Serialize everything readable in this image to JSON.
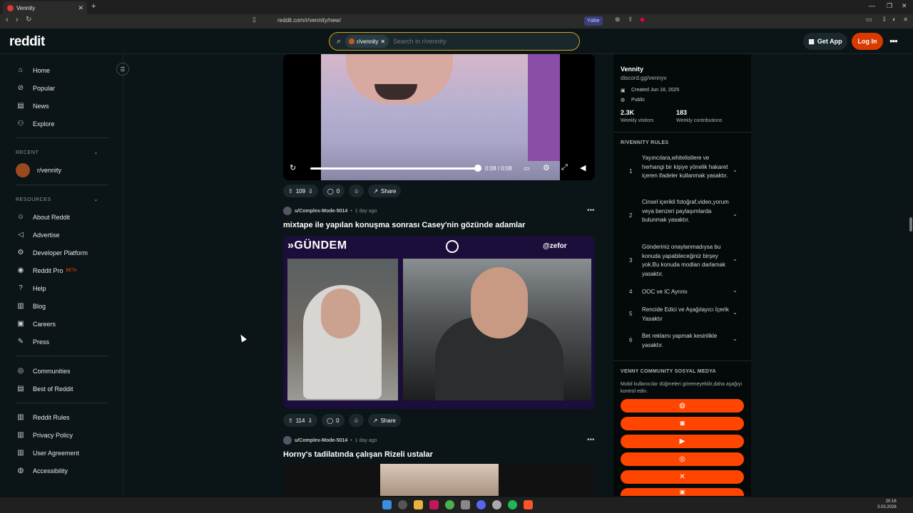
{
  "browser": {
    "tab_title": "Vennity",
    "url": "reddit.com/r/vennity/new/",
    "translate_label": "Yükle",
    "new_tab": "+",
    "close_tab": "✕"
  },
  "header": {
    "logo": "reddit",
    "search_chip": "r/vennity",
    "search_placeholder": "Search in r/vennity",
    "get_app": "Get App",
    "login": "Log In"
  },
  "sidebar": {
    "primary": [
      {
        "label": "Home",
        "icon": "home-icon",
        "glyph": "⌂"
      },
      {
        "label": "Popular",
        "icon": "popular-icon",
        "glyph": "⊘"
      },
      {
        "label": "News",
        "icon": "news-icon",
        "glyph": "▤"
      },
      {
        "label": "Explore",
        "icon": "explore-icon",
        "glyph": "⚇"
      }
    ],
    "recent_header": "RECENT",
    "recent": [
      {
        "label": "r/vennity"
      }
    ],
    "resources_header": "RESOURCES",
    "resources": [
      {
        "label": "About Reddit",
        "icon": "about-icon",
        "glyph": "☺"
      },
      {
        "label": "Advertise",
        "icon": "advertise-icon",
        "glyph": "📢"
      },
      {
        "label": "Developer Platform",
        "icon": "developer-icon",
        "glyph": "⚙"
      },
      {
        "label": "Reddit Pro",
        "icon": "pro-icon",
        "glyph": "◉",
        "badge": "BETA"
      },
      {
        "label": "Help",
        "icon": "help-icon",
        "glyph": "?"
      },
      {
        "label": "Blog",
        "icon": "blog-icon",
        "glyph": "▥"
      },
      {
        "label": "Careers",
        "icon": "careers-icon",
        "glyph": "▣"
      },
      {
        "label": "Press",
        "icon": "press-icon",
        "glyph": "✎"
      }
    ],
    "group3": [
      {
        "label": "Communities",
        "icon": "communities-icon",
        "glyph": "◎"
      },
      {
        "label": "Best of Reddit",
        "icon": "best-icon",
        "glyph": "▤"
      }
    ],
    "group4": [
      {
        "label": "Reddit Rules",
        "icon": "rules-icon",
        "glyph": "▥"
      },
      {
        "label": "Privacy Policy",
        "icon": "privacy-icon",
        "glyph": "▥"
      },
      {
        "label": "User Agreement",
        "icon": "agreement-icon",
        "glyph": "▥"
      },
      {
        "label": "Accessibility",
        "icon": "accessibility-icon",
        "glyph": "◍"
      }
    ]
  },
  "feed": {
    "video": {
      "time": "0:08 / 0:08",
      "progress": 1.0
    },
    "post1": {
      "votes": "109",
      "comments": "0",
      "share": "Share"
    },
    "post2": {
      "author": "u/Complex-Mode-5014",
      "age": "1 day ago",
      "title": "mixtape ile yapılan konuşma sonrası Casey'nin gözünde adamlar",
      "overlay_left": "GÜNDEM",
      "overlay_right": "@zefor",
      "votes": "114",
      "comments": "0",
      "share": "Share"
    },
    "post3": {
      "author": "u/Complex-Mode-5014",
      "age": "1 day ago",
      "title": "Horny's tadilatında çalışan Rizeli ustalar"
    }
  },
  "community": {
    "name": "Vennity",
    "link": "discord.gg/vennyv",
    "created": "Created Jun 18, 2025",
    "visibility": "Public",
    "visitors": "2.3K",
    "visitors_label": "Weekly visitors",
    "contributions": "183",
    "contributions_label": "Weekly contributions",
    "rules_header": "R/VENNITY RULES",
    "rules": [
      "Yayıncılara,whitelistlere ve herhangi bir kişiye yönelik hakaret içeren ifadeler kullanmak yasaktır.",
      "Cinsel içerikli fotoğraf,video,yorum veya benzeri paylaşımlarda bulunmak yasaktır.",
      "Gönderiniz onaylanmadıysa bu konuda yapabileceğiniz birşey yok.Bu konuda modları darlamak yasaktır.",
      "OOC ve IC Ayrımı",
      "Rencide Edici ve Aşağılayıcı İçerik Yasaktır",
      "Bet reklamı yapmak kesinlikle yasaktır."
    ],
    "social_header": "VENNY COMMUNITY SOSYAL MEDYA",
    "social_note": "Mobil kullanıcılar düğmeleri göremeyebilir,daha aşağıyı kontrol edin.",
    "social_buttons": [
      "web-icon",
      "discord-icon",
      "youtube-icon",
      "instagram-icon",
      "x-icon",
      "twitch-icon"
    ]
  },
  "taskbar": {
    "time": "20:16",
    "date": "3.03.2026"
  },
  "colors": {
    "accent": "#ff4500",
    "login": "#d93a00",
    "bg": "#0b1416"
  }
}
